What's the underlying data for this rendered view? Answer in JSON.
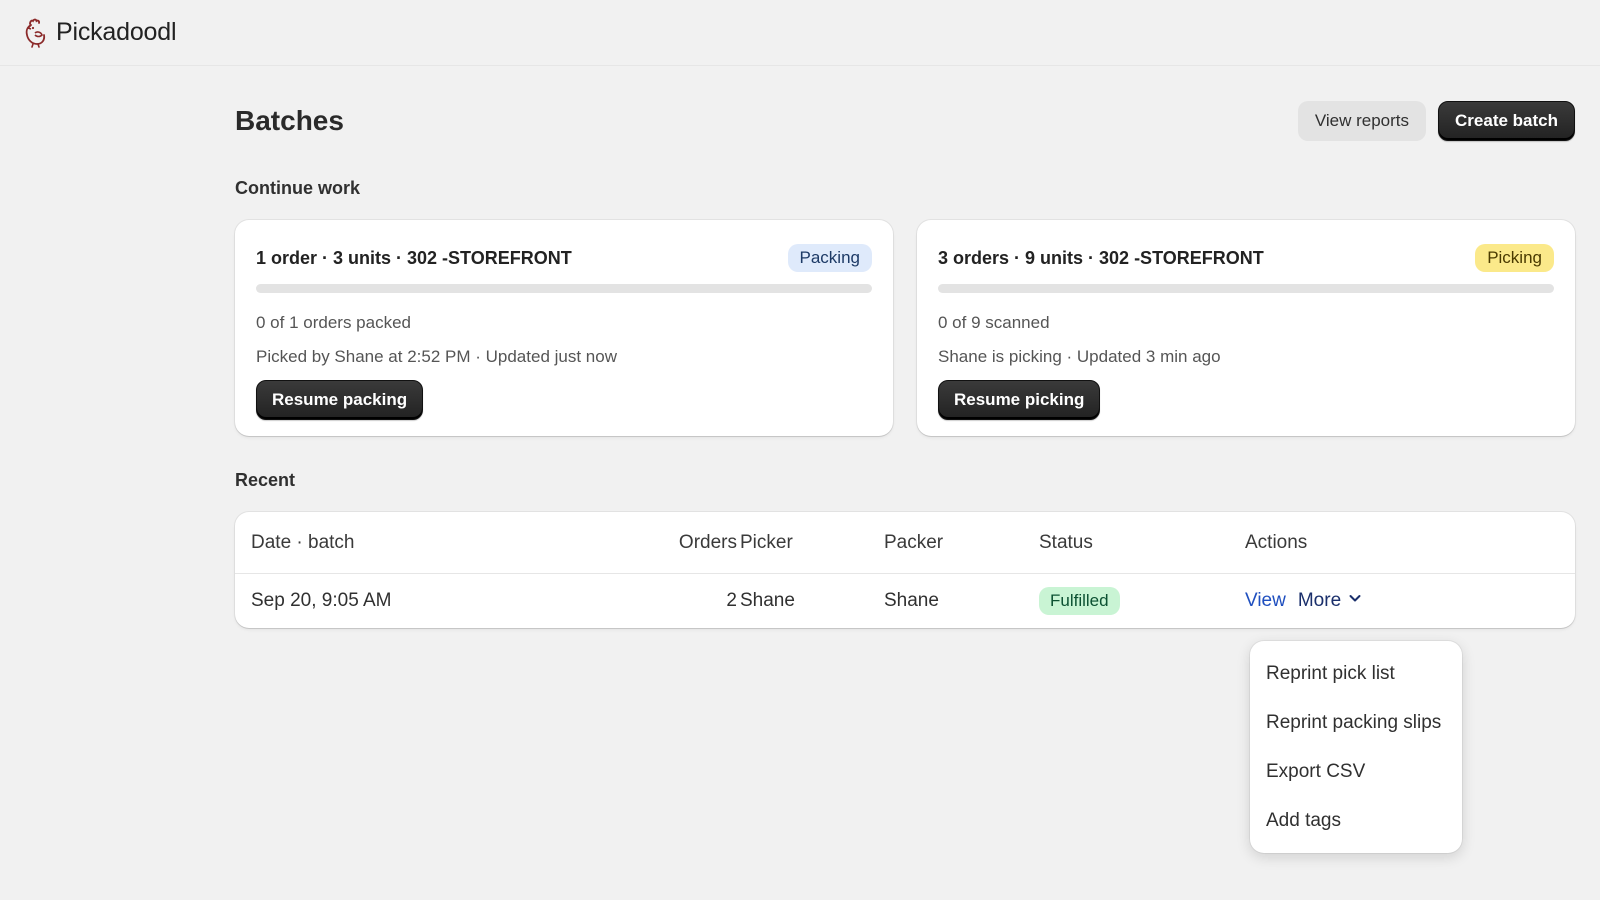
{
  "app": {
    "name": "Pickadoodl",
    "logo_icon": "rooster-icon"
  },
  "page": {
    "title": "Batches",
    "actions": {
      "view_reports": "View reports",
      "create_batch": "Create batch"
    }
  },
  "continue_work": {
    "title": "Continue work",
    "cards": [
      {
        "title": "1 order · 3 units · 302 -STOREFRONT",
        "status": "Packing",
        "progress": 0,
        "progress_text": "0 of 1 orders packed",
        "meta": "Picked by Shane at 2:52 PM · Updated just now",
        "button": "Resume packing"
      },
      {
        "title": "3 orders · 9 units · 302 -STOREFRONT",
        "status": "Picking",
        "progress": 0,
        "progress_text": "0 of 9 scanned",
        "meta": "Shane is picking · Updated 3 min ago",
        "button": "Resume picking"
      }
    ]
  },
  "recent": {
    "title": "Recent",
    "columns": {
      "date": "Date · batch",
      "orders": "Orders",
      "picker": "Picker",
      "packer": "Packer",
      "status": "Status",
      "actions": "Actions"
    },
    "rows": [
      {
        "date": "Sep 20, 9:05 AM",
        "orders": "2",
        "picker": "Shane",
        "packer": "Shane",
        "status": "Fulfilled",
        "view": "View",
        "more": "More"
      }
    ]
  },
  "more_menu": {
    "items": [
      "Reprint pick list",
      "Reprint packing slips",
      "Export CSV",
      "Add tags"
    ]
  },
  "colors": {
    "background": "#f1f1f1",
    "primary_button": "#2a2a2a",
    "packing_badge": "#dfeafb",
    "picking_badge": "#fbe98a",
    "fulfilled_badge": "#c9f4d4",
    "link": "#1f4fbf"
  }
}
